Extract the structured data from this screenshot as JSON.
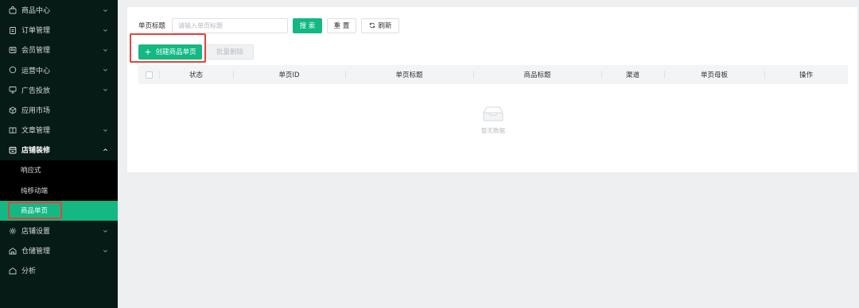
{
  "sidebar": {
    "items": [
      {
        "label": "商品中心",
        "icon": "bag-icon",
        "expandable": true
      },
      {
        "label": "订单管理",
        "icon": "clipboard-icon",
        "expandable": true
      },
      {
        "label": "会员管理",
        "icon": "member-icon",
        "expandable": true
      },
      {
        "label": "运营中心",
        "icon": "circle-icon",
        "expandable": true
      },
      {
        "label": "广告投放",
        "icon": "monitor-icon",
        "expandable": true
      },
      {
        "label": "应用市场",
        "icon": "cube-icon",
        "expandable": false
      },
      {
        "label": "文章管理",
        "icon": "book-icon",
        "expandable": true
      },
      {
        "label": "店铺装修",
        "icon": "store-icon",
        "expandable": true,
        "open": true,
        "children": [
          {
            "label": "响应式"
          },
          {
            "label": "纯移动端"
          },
          {
            "label": "商品单页",
            "active": true
          }
        ]
      },
      {
        "label": "店铺设置",
        "icon": "gear-icon",
        "expandable": true
      },
      {
        "label": "仓储管理",
        "icon": "warehouse-icon",
        "expandable": true
      },
      {
        "label": "分析",
        "icon": "home-icon",
        "expandable": false
      }
    ]
  },
  "search": {
    "label": "单页标题",
    "placeholder": "请输入单页标题",
    "value": "",
    "search_button": "搜 索",
    "reset_button": "重 置",
    "refresh_button": "刷新"
  },
  "actions": {
    "create_button": "创建商品单页",
    "batch_delete_button": "批量删除"
  },
  "table": {
    "columns": [
      "状态",
      "单页ID",
      "单页标题",
      "商品标题",
      "渠道",
      "单页母板",
      "操作"
    ],
    "rows": [],
    "empty_text": "暂无数据"
  },
  "colors": {
    "sidebar_bg": "#061a16",
    "primary": "#13b883",
    "highlight_box": "#e2453d"
  }
}
